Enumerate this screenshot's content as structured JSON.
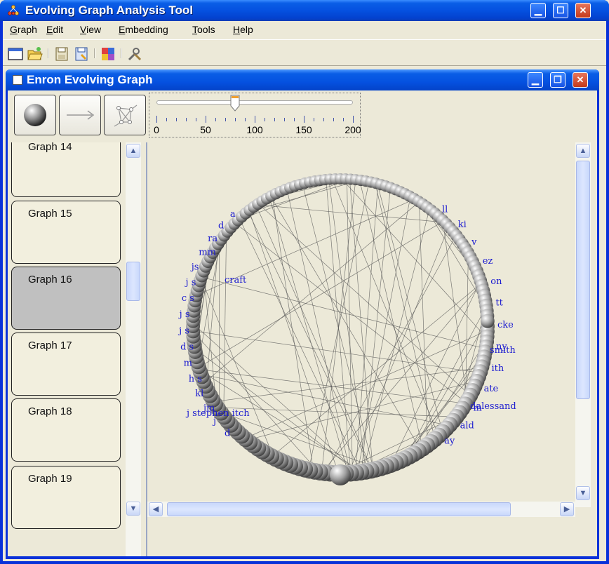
{
  "app": {
    "title": "Evolving Graph Analysis Tool"
  },
  "menu": [
    {
      "label": "Graph",
      "u": "G",
      "rest": "raph"
    },
    {
      "label": "Edit",
      "u": "E",
      "rest": "dit"
    },
    {
      "label": "View",
      "u": "V",
      "rest": "iew"
    },
    {
      "label": "Embedding",
      "u": "E",
      "rest": "mbedding"
    },
    {
      "label": "Tools",
      "u": "T",
      "rest": "ools"
    },
    {
      "label": "Help",
      "u": "H",
      "rest": "elp"
    }
  ],
  "toolbar": {
    "icons": [
      "new-window-icon",
      "open-folder-icon",
      "save-icon",
      "save-as-icon",
      "color-palette-icon",
      "tools-icon"
    ]
  },
  "document": {
    "title": "Enron Evolving Graph"
  },
  "controls": {
    "slider": {
      "value": 80,
      "min": 0,
      "max": 200,
      "labels": [
        "0",
        "50",
        "100",
        "150",
        "200"
      ]
    }
  },
  "graphs": [
    {
      "label": "Graph 14",
      "selected": false
    },
    {
      "label": "Graph 15",
      "selected": false
    },
    {
      "label": "Graph 16",
      "selected": true
    },
    {
      "label": "Graph 17",
      "selected": false
    },
    {
      "label": "Graph 18",
      "selected": false
    },
    {
      "label": "Graph 19",
      "selected": false
    }
  ],
  "visualization": {
    "node_color": "#1a1ad0",
    "edge_color": "#555555",
    "node_labels_left": [
      "d",
      "j",
      "jm",
      "kl",
      "h s",
      "m",
      "d s",
      "j s",
      "j s",
      "c s",
      "j s",
      "js",
      "mm",
      "ra",
      "d",
      "a"
    ],
    "node_labels_right": [
      "ll",
      "ki",
      "v",
      "ez",
      "on",
      "tt",
      "cke",
      "ny",
      "ith",
      "ate",
      "m",
      "ald",
      "ay"
    ],
    "node_labels_named": [
      "craft",
      "j stephen itch",
      "smith",
      "dalessand"
    ]
  },
  "colors": {
    "titlebar": "#0551e0",
    "face": "#ece9d8",
    "selected_card": "#c0c0c0"
  }
}
